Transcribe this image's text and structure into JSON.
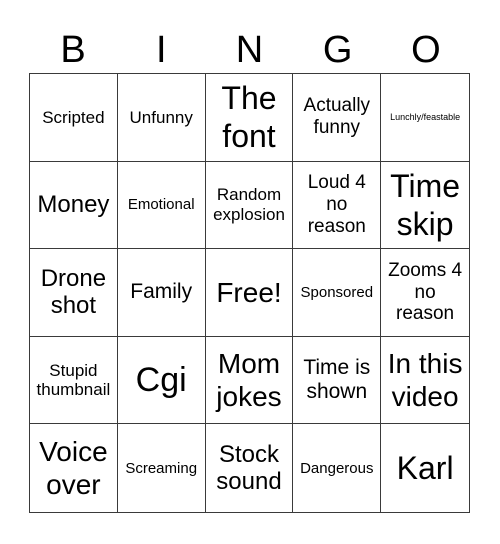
{
  "card": {
    "header": [
      "B",
      "I",
      "N",
      "G",
      "O"
    ],
    "cells": [
      "Scripted",
      "Unfunny",
      "The font",
      "Actually funny",
      "Lunchly/feastable",
      "Money",
      "Emotional",
      "Random explosion",
      "Loud 4 no reason",
      "Time skip",
      "Drone shot",
      "Family",
      "Free!",
      "Sponsored",
      "Zooms 4 no reason",
      "Stupid thumbnail",
      "Cgi",
      "Mom jokes",
      "Time is shown",
      "In this video",
      "Voice over",
      "Screaming",
      "Stock sound",
      "Dangerous",
      "Karl"
    ],
    "free_space_index": 12
  },
  "colors": {
    "grid_line": "#3a3a3a",
    "text": "#000000",
    "background": "#ffffff"
  }
}
